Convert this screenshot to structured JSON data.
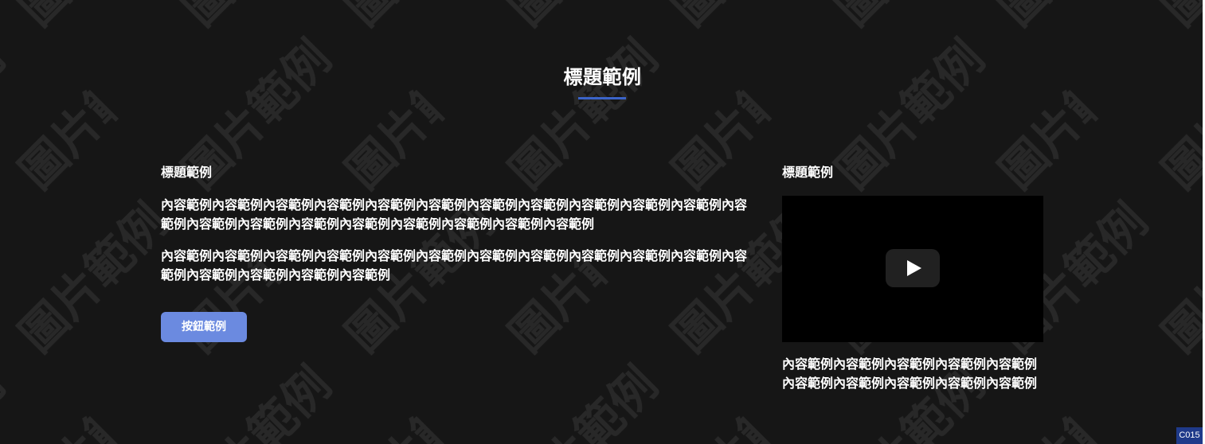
{
  "watermark": {
    "text": "圖片範例"
  },
  "header": {
    "title": "標題範例"
  },
  "content": {
    "heading": "標題範例",
    "paragraphs": [
      "內容範例內容範例內容範例內容範例內容範例內容範例內容範例內容範例內容範例內容範例內容範例內容範例內容範例內容範例內容範例內容範例內容範例內容範例內容範例內容範例",
      "內容範例內容範例內容範例內容範例內容範例內容範例內容範例內容範例內容範例內容範例內容範例內容範例內容範例內容範例內容範例內容範例"
    ],
    "button_label": "按鈕範例"
  },
  "media": {
    "heading": "標題範例",
    "play_icon": "play-icon",
    "caption": [
      "內容範例內容範例內容範例內容範例內容範例",
      "內容範例內容範例內容範例內容範例內容範例"
    ]
  },
  "page_code": "C015",
  "colors": {
    "background": "#161616",
    "accent": "#3b64c9",
    "button": "#6b8ae0",
    "video_bg": "#000000",
    "badge": "#1f3a8a"
  }
}
